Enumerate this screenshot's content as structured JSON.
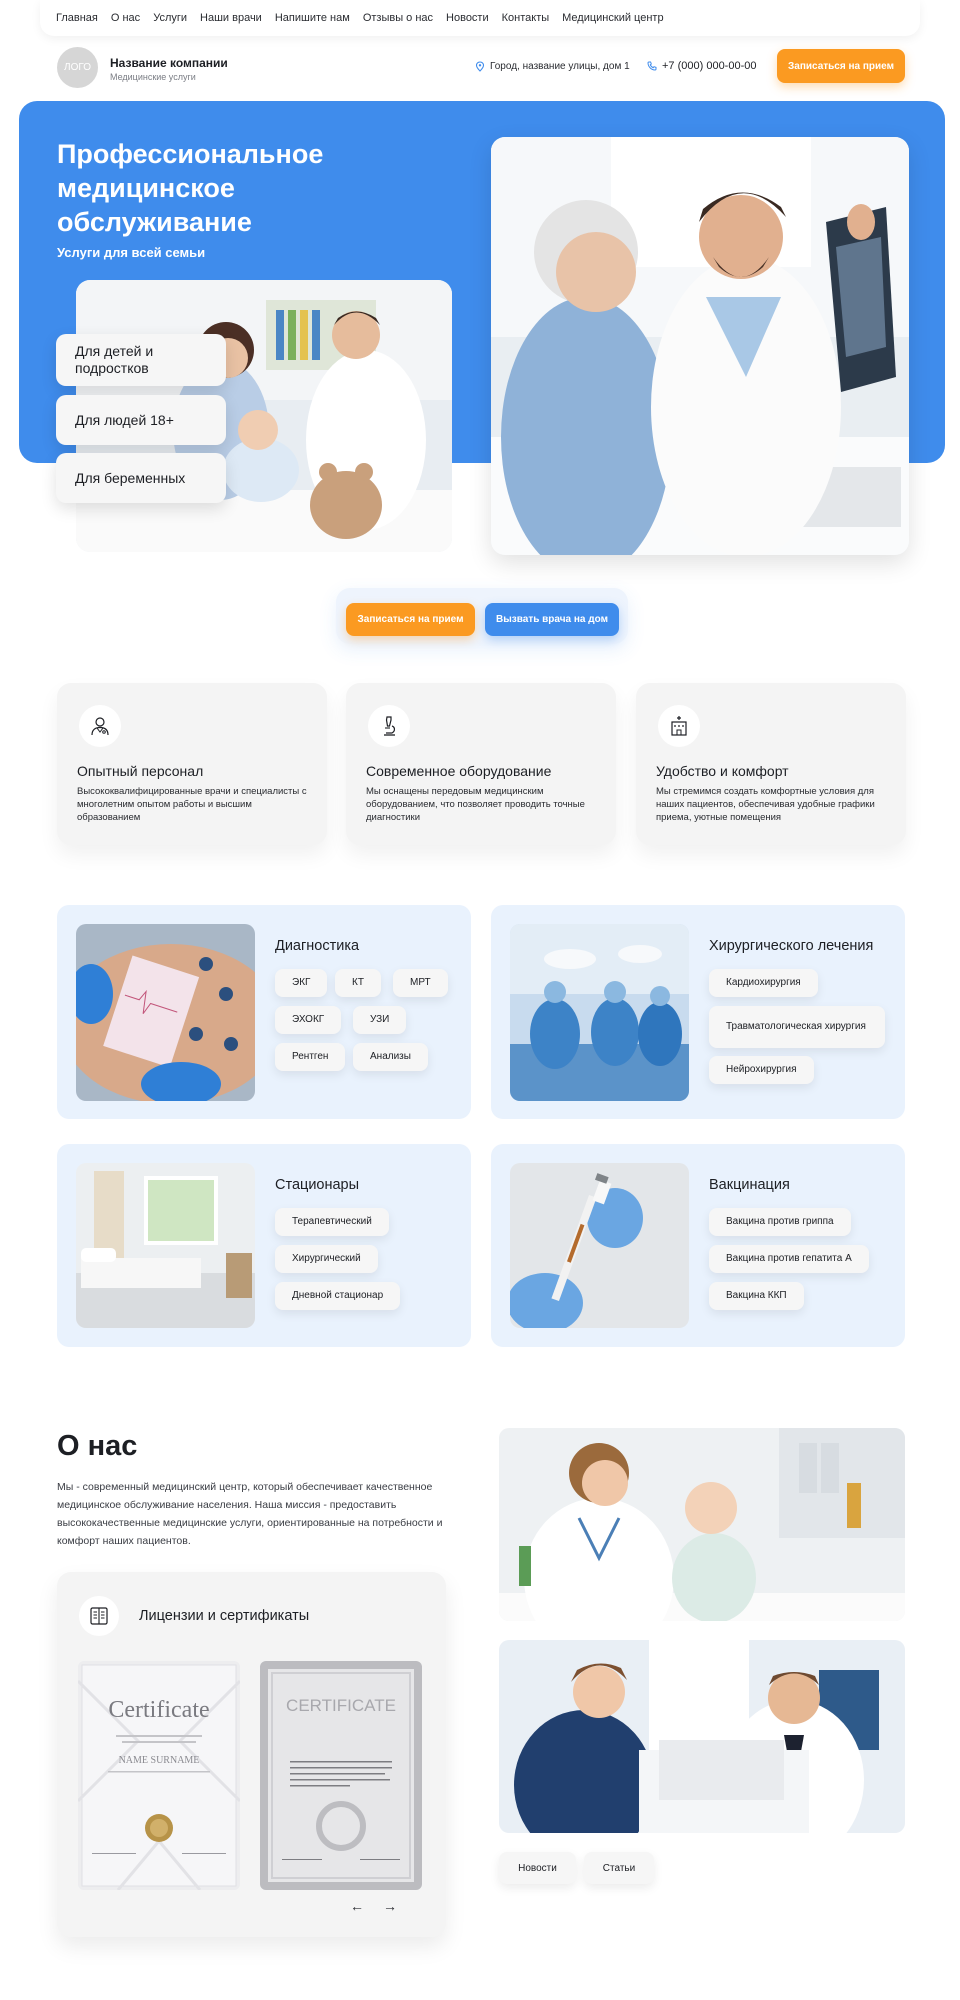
{
  "nav": {
    "items": [
      "Главная",
      "О нас",
      "Услуги",
      "Наши врачи",
      "Напишите нам",
      "Отзывы о нас",
      "Новости",
      "Контакты",
      "Медицинский центр"
    ]
  },
  "header": {
    "logo": "ЛОГО",
    "company_name": "Название компании",
    "company_sub": "Медицинские услуги",
    "address": "Город, название улицы, дом 1",
    "phone": "+7 (000) 000-00-00",
    "cta": "Записаться на прием"
  },
  "hero": {
    "title": "Профессиональное медицинское обслуживание",
    "subtitle": "Услуги для всей семьи",
    "pills": [
      "Для детей и подростков",
      "Для людей  18+",
      "Для беременных"
    ]
  },
  "cta_block": {
    "appointment": "Записаться на прием",
    "home_call": "Вызвать врача на дом"
  },
  "features": [
    {
      "icon": "doctor-icon",
      "title": "Опытный персонал",
      "text": "Высококвалифицированные врачи и специалисты с многолетним опытом работы и высшим образованием"
    },
    {
      "icon": "microscope-icon",
      "title": "Современное оборудование",
      "text": "Мы оснащены передовым медицинским оборудованием, что позволяет проводить точные диагностики"
    },
    {
      "icon": "hospital-icon",
      "title": "Удобство и комфорт",
      "text": "Мы стремимся создать комфортные условия для наших пациентов, обеспечивая удобные графики приема, уютные помещения"
    }
  ],
  "services": {
    "diagnostics": {
      "title": "Диагностика",
      "tags": [
        "ЭКГ",
        "КТ",
        "МРТ",
        "ЭХОКГ",
        "УЗИ",
        "Рентген",
        "Анализы"
      ]
    },
    "surgery": {
      "title": "Хирургического лечения",
      "tags": [
        "Кардиохирургия",
        "Травматологическая хирургия",
        "Нейрохирургия"
      ]
    },
    "hospital": {
      "title": "Стационары",
      "tags": [
        "Терапевтический",
        "Хирургический",
        "Дневной стационар"
      ]
    },
    "vaccination": {
      "title": "Вакцинация",
      "tags": [
        "Вакцина против гриппа",
        "Вакцина против гепатита А",
        "Вакцина ККП"
      ]
    }
  },
  "about": {
    "title": "О нас",
    "text": "Мы - современный медицинский центр, который обеспечивает качественное медицинское обслуживание населения. Наша миссия - предоставить высококачественные медицинские услуги, ориентированные на потребности и комфорт наших пациентов.",
    "licenses_title": "Лицензии и сертификаты",
    "cert1_title": "Certificate",
    "cert1_name": "NAME SURNAME",
    "cert2_title": "CERTIFICATE",
    "prev": "←",
    "next": "→",
    "tabs": [
      "Новости",
      "Статьи"
    ]
  },
  "colors": {
    "primary_blue": "#3f8cec",
    "accent_orange": "#fb9a21",
    "card_gray": "#f4f4f4",
    "service_bg": "#e9f2fd"
  }
}
